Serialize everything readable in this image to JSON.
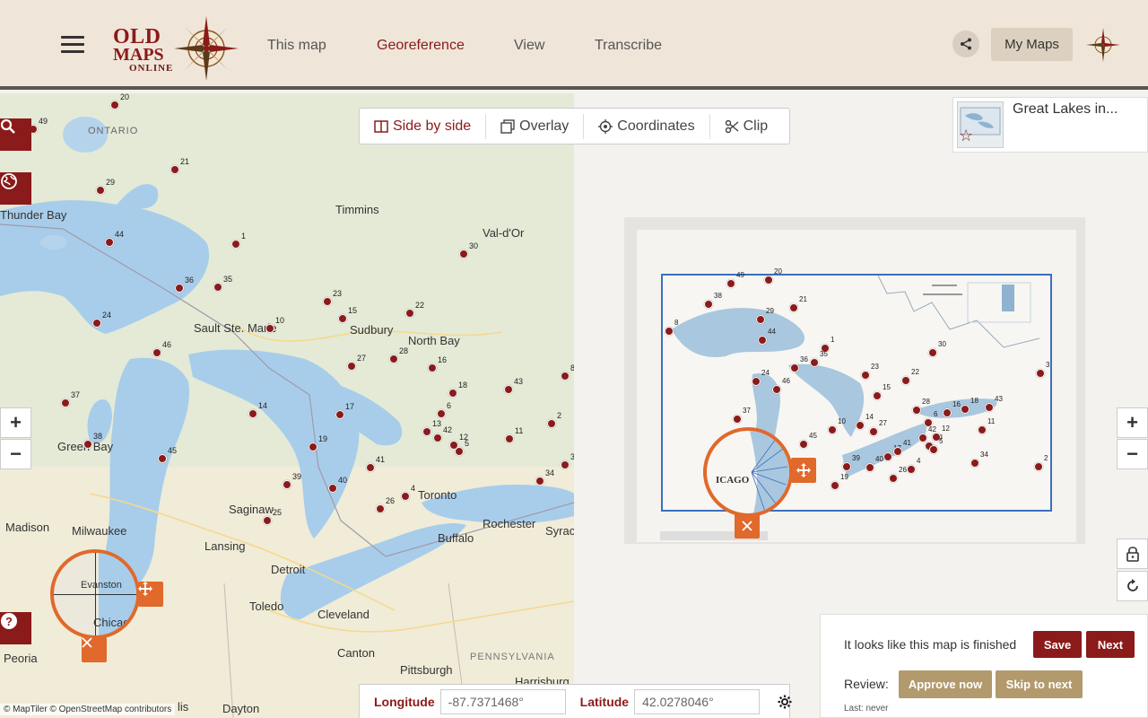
{
  "header": {
    "logo": {
      "line1": "OLD",
      "line2": "MAPS",
      "line3": "ONLINE"
    },
    "nav": [
      {
        "label": "This map",
        "active": false
      },
      {
        "label": "Georeference",
        "active": true
      },
      {
        "label": "View",
        "active": false
      },
      {
        "label": "Transcribe",
        "active": false
      }
    ],
    "my_maps_label": "My Maps"
  },
  "toolbar": {
    "side_by_side": "Side by side",
    "overlay": "Overlay",
    "coordinates": "Coordinates",
    "clip": "Clip"
  },
  "thumbnail": {
    "title": "Great Lakes in..."
  },
  "map_labels": {
    "ontario": "ONTARIO",
    "thunder_bay": "Thunder Bay",
    "timmins": "Timmins",
    "val_dor": "Val-d'Or",
    "sault": "Sault Ste. Marie",
    "sudbury": "Sudbury",
    "north_bay": "North Bay",
    "green_bay": "Green Bay",
    "madison": "Madison",
    "milwaukee": "Milwaukee",
    "saginaw": "Saginaw",
    "lansing": "Lansing",
    "toronto": "Toronto",
    "rochester": "Rochester",
    "syracuse": "Syrac",
    "buffalo": "Buffalo",
    "detroit": "Detroit",
    "toledo": "Toledo",
    "cleveland": "Cleveland",
    "canton": "Canton",
    "pittsburgh": "Pittsburgh",
    "pennsylvania": "PENNSYLVANIA",
    "harrisburg": "Harrisburg",
    "peoria": "Peoria",
    "dayton": "Dayton",
    "evanston": "Evanston",
    "chicago": "Chicago",
    "lis": "lis"
  },
  "left_points": [
    {
      "n": "20"
    },
    {
      "n": "49"
    },
    {
      "n": "21"
    },
    {
      "n": "29"
    },
    {
      "n": "44"
    },
    {
      "n": "1"
    },
    {
      "n": "30"
    },
    {
      "n": "36"
    },
    {
      "n": "35"
    },
    {
      "n": "23"
    },
    {
      "n": "15"
    },
    {
      "n": "22"
    },
    {
      "n": "24"
    },
    {
      "n": "10"
    },
    {
      "n": "46"
    },
    {
      "n": "27"
    },
    {
      "n": "28"
    },
    {
      "n": "16"
    },
    {
      "n": "37"
    },
    {
      "n": "14"
    },
    {
      "n": "17"
    },
    {
      "n": "18"
    },
    {
      "n": "43"
    },
    {
      "n": "6"
    },
    {
      "n": "38"
    },
    {
      "n": "45"
    },
    {
      "n": "19"
    },
    {
      "n": "13"
    },
    {
      "n": "42"
    },
    {
      "n": "12"
    },
    {
      "n": "5"
    },
    {
      "n": "11"
    },
    {
      "n": "2"
    },
    {
      "n": "41"
    },
    {
      "n": "39"
    },
    {
      "n": "40"
    },
    {
      "n": "4"
    },
    {
      "n": "26"
    },
    {
      "n": "34"
    },
    {
      "n": "25"
    },
    {
      "n": "8"
    },
    {
      "n": "3"
    }
  ],
  "coords": {
    "longitude_label": "Longitude",
    "longitude_value": "-87.7371468°",
    "latitude_label": "Latitude",
    "latitude_value": "42.0278046°"
  },
  "finish": {
    "message": "It looks like this map is finished",
    "save": "Save",
    "next": "Next",
    "review_label": "Review:",
    "approve": "Approve now",
    "skip": "Skip to next",
    "last": "Last: never"
  },
  "attribution": "© MapTiler © OpenStreetMap contributors",
  "colors": {
    "brand": "#8b1a1a",
    "accent_orange": "#e0692b",
    "tan": "#b29a6c"
  }
}
